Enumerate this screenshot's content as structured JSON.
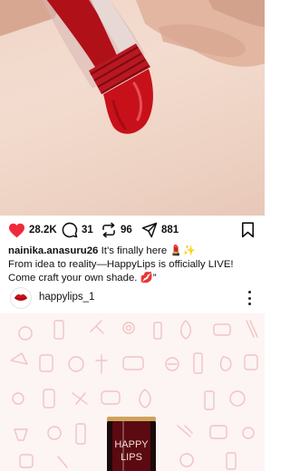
{
  "post": {
    "likes": "28.2K",
    "comments": "31",
    "reposts": "96",
    "shares": "881",
    "username": "nainika.anasuru26",
    "caption_line1": "It’s finally here 💄✨",
    "caption_line2": "From idea to reality—HappyLips is officially LIVE!",
    "caption_line3": "Come craft your own shade. 💋”"
  },
  "account": {
    "name": "happylips_1"
  },
  "preview": {
    "label_line1": "HAPPY",
    "label_line2": "LIPS"
  },
  "colors": {
    "like": "#f0283c",
    "lipstick": "#c8101a",
    "background": "#ffffff"
  },
  "icons": [
    "heart-icon",
    "comment-icon",
    "repost-icon",
    "share-icon",
    "bookmark-icon",
    "more-icon"
  ]
}
